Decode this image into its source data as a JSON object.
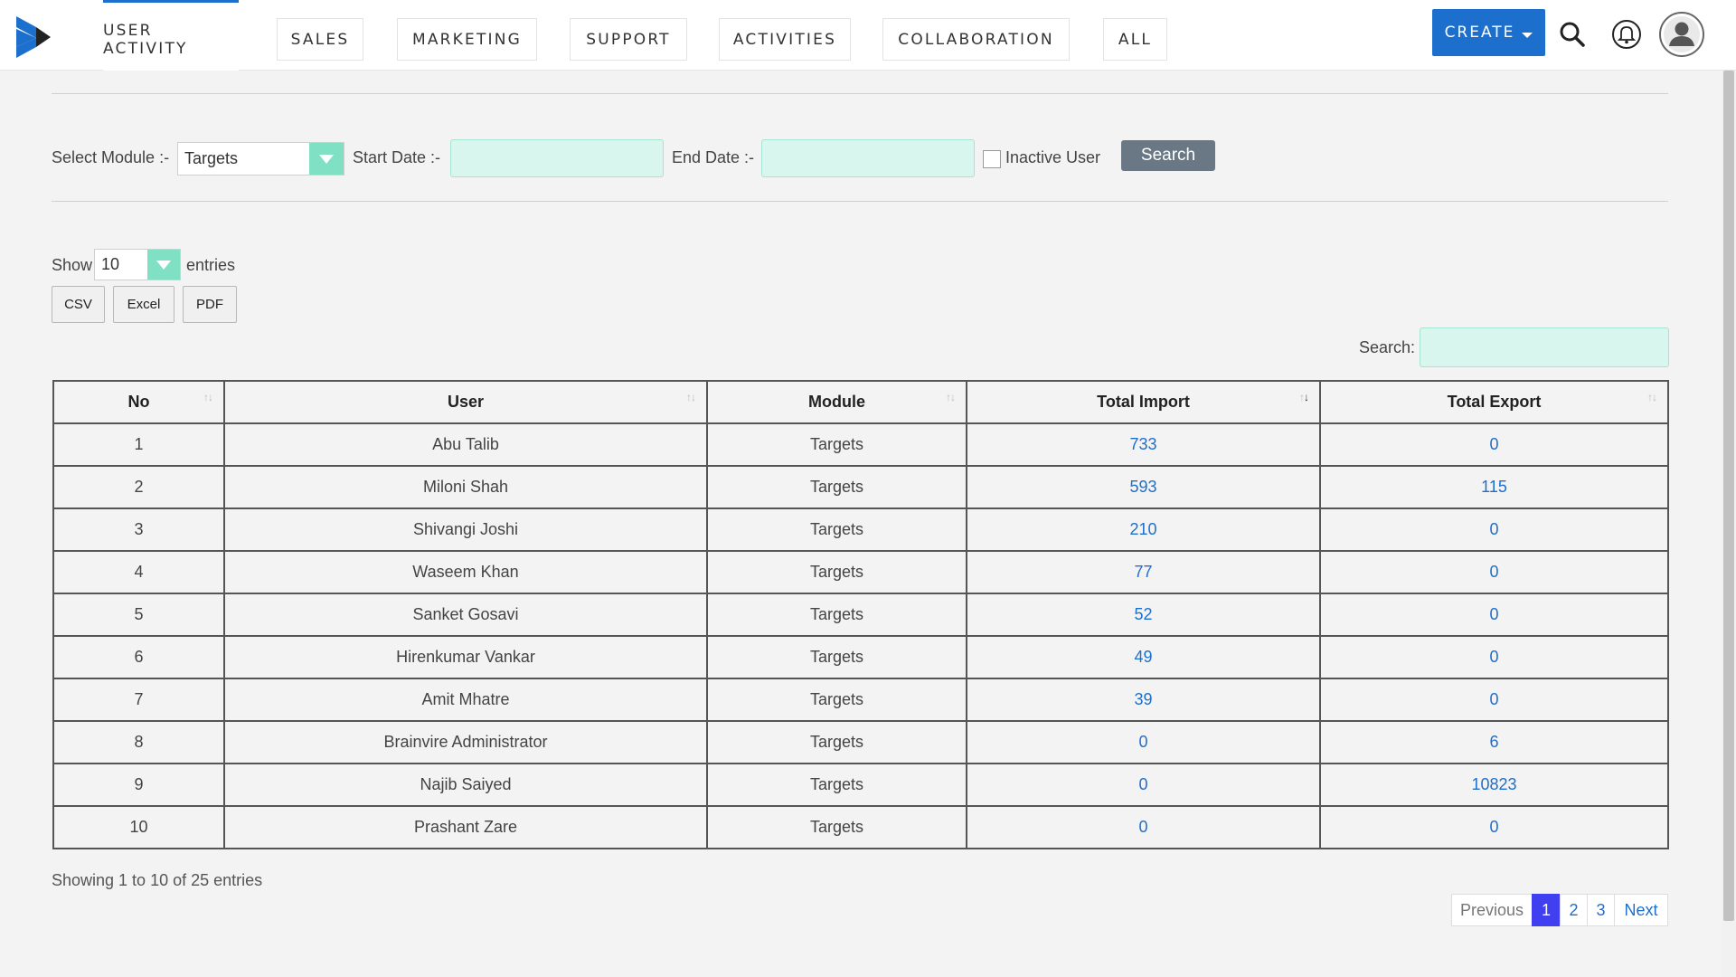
{
  "nav": {
    "items": [
      "USER ACTIVITY",
      "SALES",
      "MARKETING",
      "SUPPORT",
      "ACTIVITIES",
      "COLLABORATION",
      "ALL"
    ],
    "create_label": "CREATE",
    "brand_color": "#1d6fce"
  },
  "filters": {
    "module_label": "Select Module :-",
    "module_value": "Targets",
    "start_label": "Start Date :-",
    "start_value": "",
    "end_label": "End Date :-",
    "end_value": "",
    "inactive_label": "Inactive User",
    "inactive_checked": false,
    "search_button": "Search"
  },
  "entries": {
    "show_label": "Show",
    "value": "10",
    "suffix": "entries"
  },
  "export_buttons": [
    "CSV",
    "Excel",
    "PDF"
  ],
  "table_search": {
    "label": "Search:",
    "value": ""
  },
  "table": {
    "columns": [
      "No",
      "User",
      "Module",
      "Total Import",
      "Total Export"
    ],
    "sorted_column": "Total Import",
    "rows": [
      [
        "1",
        "Abu Talib",
        "Targets",
        "733",
        "0"
      ],
      [
        "2",
        "Miloni Shah",
        "Targets",
        "593",
        "115"
      ],
      [
        "3",
        "Shivangi Joshi",
        "Targets",
        "210",
        "0"
      ],
      [
        "4",
        "Waseem Khan",
        "Targets",
        "77",
        "0"
      ],
      [
        "5",
        "Sanket Gosavi",
        "Targets",
        "52",
        "0"
      ],
      [
        "6",
        "Hirenkumar Vankar",
        "Targets",
        "49",
        "0"
      ],
      [
        "7",
        "Amit Mhatre",
        "Targets",
        "39",
        "0"
      ],
      [
        "8",
        "Brainvire Administrator",
        "Targets",
        "0",
        "6"
      ],
      [
        "9",
        "Najib Saiyed",
        "Targets",
        "0",
        "10823"
      ],
      [
        "10",
        "Prashant Zare",
        "Targets",
        "0",
        "0"
      ]
    ]
  },
  "info_text": "Showing 1 to 10 of 25 entries",
  "pagination": {
    "previous": "Previous",
    "pages": [
      "1",
      "2",
      "3"
    ],
    "current": "1",
    "next": "Next"
  }
}
